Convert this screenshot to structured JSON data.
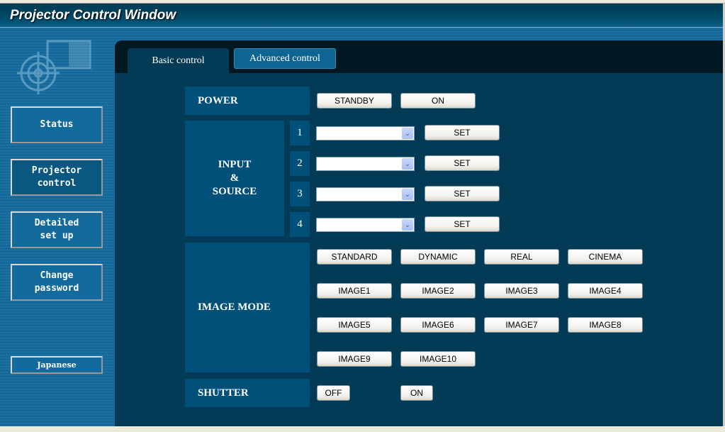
{
  "window": {
    "title": "Projector Control Window"
  },
  "sidebar": {
    "items": [
      {
        "label": "Status"
      },
      {
        "label": "Projector control"
      },
      {
        "label": "Detailed set up"
      },
      {
        "label": "Change password"
      }
    ],
    "language": "Japanese"
  },
  "tabs": [
    {
      "label": "Basic control",
      "active": true
    },
    {
      "label": "Advanced control",
      "active": false
    }
  ],
  "power": {
    "label": "POWER",
    "standby": "STANDBY",
    "on": "ON"
  },
  "input": {
    "label_line1": "INPUT",
    "label_line2": "&",
    "label_line3": "SOURCE",
    "rows": [
      {
        "number": "1",
        "value": "",
        "set": "SET"
      },
      {
        "number": "2",
        "value": "",
        "set": "SET"
      },
      {
        "number": "3",
        "value": "",
        "set": "SET"
      },
      {
        "number": "4",
        "value": "",
        "set": "SET"
      }
    ]
  },
  "image_mode": {
    "label": "IMAGE MODE",
    "buttons": [
      "STANDARD",
      "DYNAMIC",
      "REAL",
      "CINEMA",
      "IMAGE1",
      "IMAGE2",
      "IMAGE3",
      "IMAGE4",
      "IMAGE5",
      "IMAGE6",
      "IMAGE7",
      "IMAGE8",
      "IMAGE9",
      "IMAGE10"
    ]
  },
  "shutter": {
    "label": "SHUTTER",
    "off": "OFF",
    "on": "ON"
  },
  "colors": {
    "panel": "#033a56",
    "label_block": "#00507a",
    "sidebar": "#1a70a2",
    "tab_inactive": "#0e6592"
  }
}
